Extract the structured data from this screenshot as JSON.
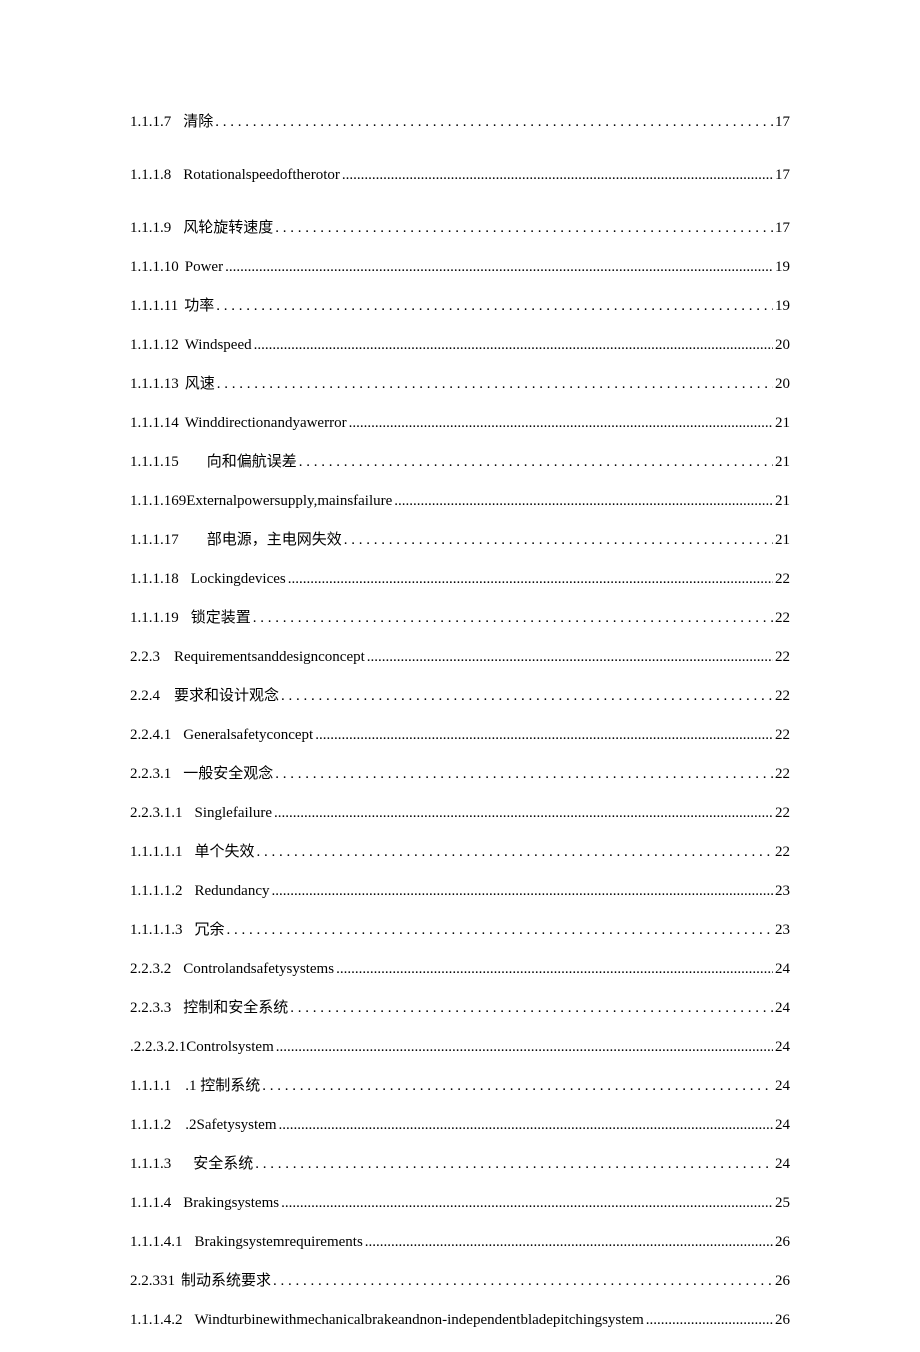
{
  "toc": [
    {
      "num": "1.1.1.7",
      "title": "清除",
      "page": "17",
      "gap": 38,
      "leader": "sparse",
      "labelGap": 12
    },
    {
      "num": "1.1.1.8",
      "title": "Rotationalspeedoftherotor",
      "page": "17",
      "gap": 38,
      "leader": "dense",
      "labelGap": 12
    },
    {
      "num": "1.1.1.9",
      "title": "风轮旋转速度",
      "page": "17",
      "gap": 24,
      "leader": "sparse",
      "labelGap": 12
    },
    {
      "num": "1.1.1.10",
      "title": "Power",
      "page": "19",
      "gap": 24,
      "leader": "dense",
      "labelGap": 6
    },
    {
      "num": "1.1.1.11",
      "title": "功率",
      "page": "19",
      "gap": 24,
      "leader": "sparse",
      "labelGap": 6
    },
    {
      "num": "1.1.1.12",
      "title": "Windspeed",
      "page": "20",
      "gap": 24,
      "leader": "dense",
      "labelGap": 6
    },
    {
      "num": "1.1.1.13",
      "title": "风速",
      "page": "20",
      "gap": 24,
      "leader": "sparse",
      "labelGap": 6
    },
    {
      "num": "1.1.1.14",
      "title": "Winddirectionandyawerror",
      "page": "21",
      "gap": 24,
      "leader": "dense",
      "labelGap": 6
    },
    {
      "num": "1.1.1.15",
      "title": "向和偏航误差",
      "page": "21",
      "gap": 24,
      "leader": "sparse",
      "labelGap": 28
    },
    {
      "num": "1.1.1.169",
      "title": "Externalpowersupply,mainsfailure",
      "page": "21",
      "gap": 24,
      "leader": "dense",
      "labelGap": 0
    },
    {
      "num": "1.1.1.17",
      "title": "部电源，主电网失效",
      "page": "21",
      "gap": 24,
      "leader": "sparse",
      "labelGap": 28
    },
    {
      "num": "1.1.1.18",
      "title": "Lockingdevices",
      "page": "22",
      "gap": 24,
      "leader": "dense",
      "labelGap": 12
    },
    {
      "num": "1.1.1.19",
      "title": "锁定装置",
      "page": "22",
      "gap": 24,
      "leader": "sparse",
      "labelGap": 12
    },
    {
      "num": "2.2.3",
      "title": "Requirementsanddesignconcept",
      "page": "22",
      "gap": 24,
      "leader": "dense",
      "labelGap": 14
    },
    {
      "num": "2.2.4",
      "title": "要求和设计观念",
      "page": "22",
      "gap": 24,
      "leader": "sparse",
      "labelGap": 14
    },
    {
      "num": "2.2.4.1",
      "title": "Generalsafetyconcept",
      "page": "22",
      "gap": 24,
      "leader": "dense",
      "labelGap": 12
    },
    {
      "num": "2.2.3.1",
      "title": "一般安全观念",
      "page": "22",
      "gap": 24,
      "leader": "sparse",
      "labelGap": 12
    },
    {
      "num": "2.2.3.1.1",
      "title": "Singlefailure",
      "page": "22",
      "gap": 24,
      "leader": "dense",
      "labelGap": 12
    },
    {
      "num": "1.1.1.1.1",
      "title": "单个失效",
      "page": "22",
      "gap": 24,
      "leader": "sparse",
      "labelGap": 12
    },
    {
      "num": "1.1.1.1.2",
      "title": "Redundancy",
      "page": "23",
      "gap": 24,
      "leader": "dense",
      "labelGap": 12
    },
    {
      "num": "1.1.1.1.3",
      "title": "冗余",
      "page": "23",
      "gap": 24,
      "leader": "sparse",
      "labelGap": 12
    },
    {
      "num": "2.2.3.2",
      "title": "Controlandsafetysystems",
      "page": "24",
      "gap": 24,
      "leader": "dense",
      "labelGap": 12
    },
    {
      "num": "2.2.3.3",
      "title": "控制和安全系统",
      "page": "24",
      "gap": 24,
      "leader": "sparse",
      "labelGap": 12
    },
    {
      "num": ".2.2.3.2.1",
      "title": "Controlsystem",
      "page": "24",
      "gap": 24,
      "leader": "dense",
      "labelGap": 0
    },
    {
      "num": "1.1.1.1",
      "title": ".1 控制系统",
      "page": "24",
      "gap": 24,
      "leader": "sparse",
      "labelGap": 14
    },
    {
      "num": "1.1.1.2",
      "title": ".2Safetysystem",
      "page": "24",
      "gap": 24,
      "leader": "dense",
      "labelGap": 14
    },
    {
      "num": "1.1.1.3",
      "title": "安全系统",
      "page": "24",
      "gap": 24,
      "leader": "sparse",
      "labelGap": 22
    },
    {
      "num": "1.1.1.4",
      "title": "Brakingsystems",
      "page": "25",
      "gap": 24,
      "leader": "dense",
      "labelGap": 12
    },
    {
      "num": "1.1.1.4.1",
      "title": "Brakingsystemrequirements",
      "page": "26",
      "gap": 24,
      "leader": "dense",
      "labelGap": 12
    },
    {
      "num": "2.2.331",
      "title": "制动系统要求",
      "page": "26",
      "gap": 24,
      "leader": "sparse",
      "labelGap": 6
    },
    {
      "num": "1.1.1.4.2",
      "title": "Windturbinewithmechanicalbrakeandnon-independentbladepitchingsystem",
      "page": "26",
      "gap": 24,
      "leader": "dense",
      "labelGap": 12
    }
  ]
}
